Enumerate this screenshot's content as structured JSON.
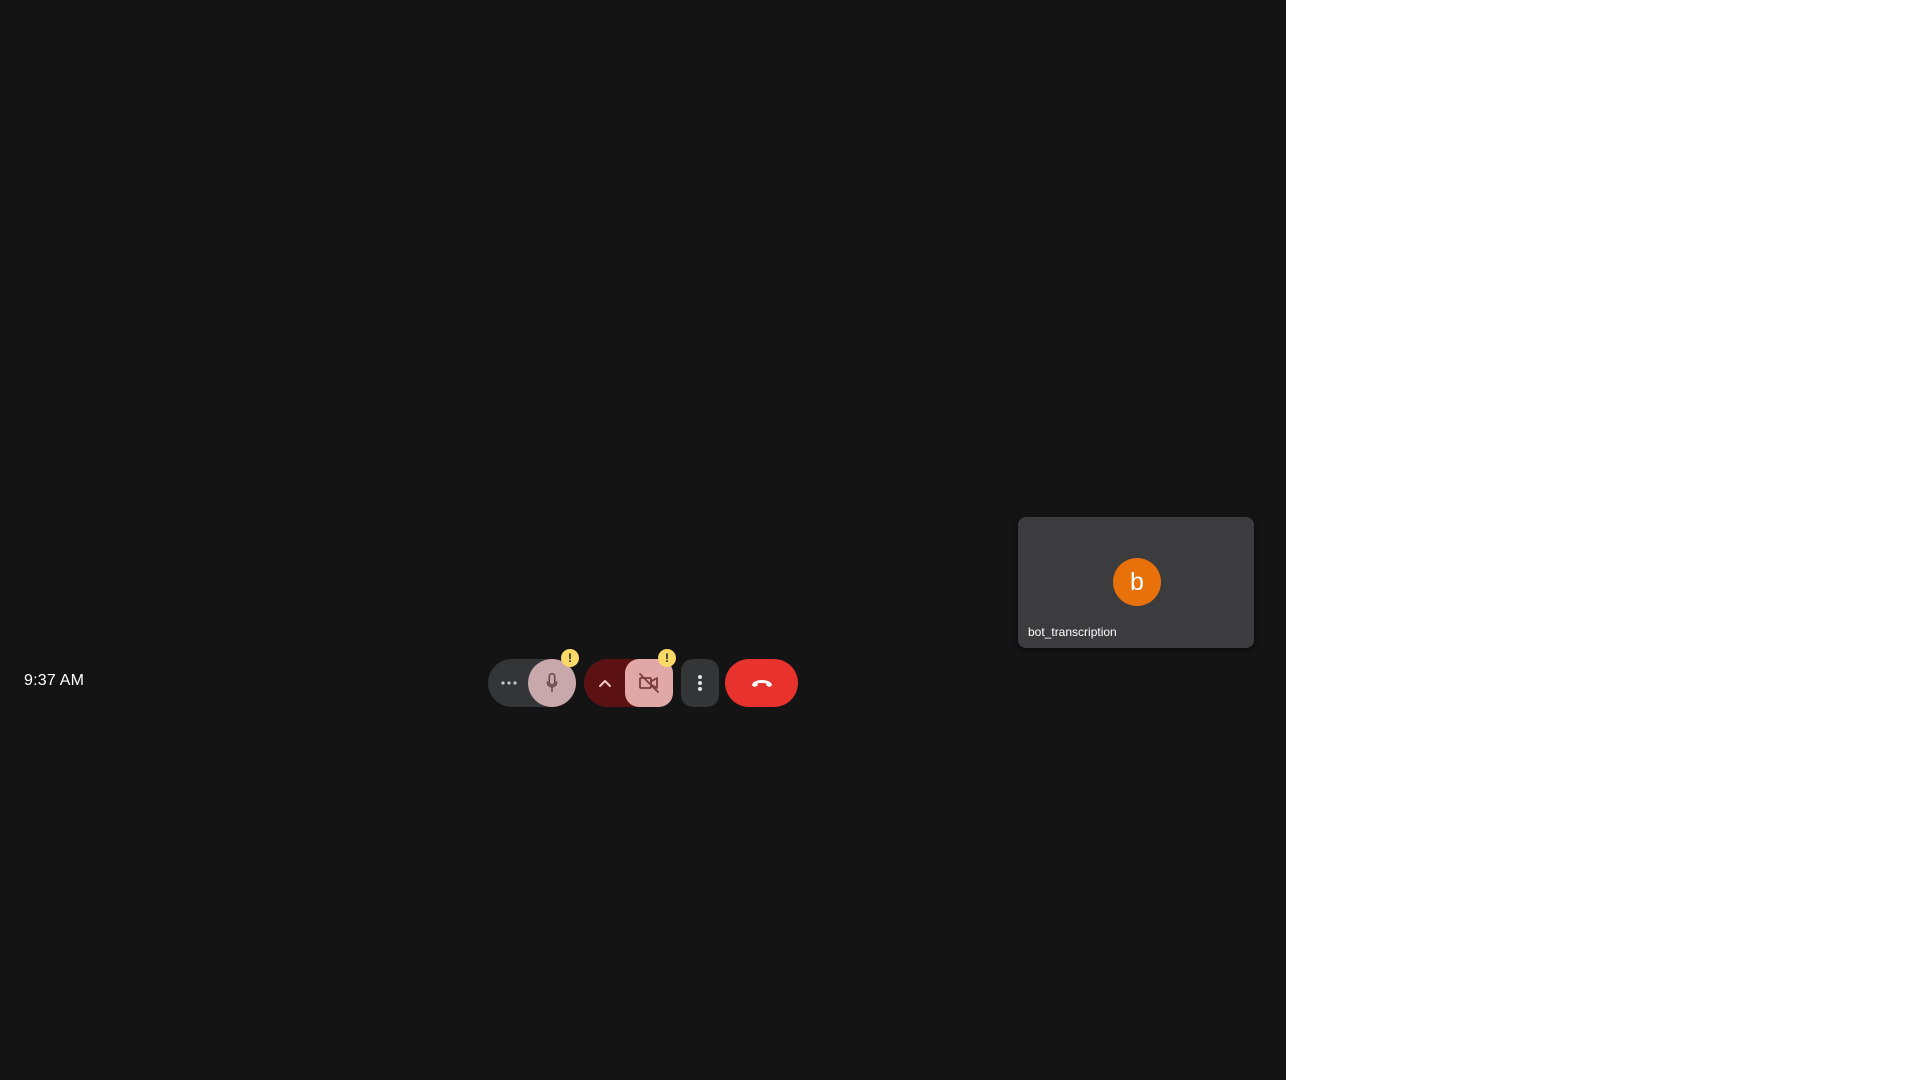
{
  "clock": {
    "time": "9:37 AM"
  },
  "participant": {
    "initial": "b",
    "name": "bot_transcription",
    "avatar_color": "#e8710a"
  },
  "controls": {
    "audio_options_icon": "more-horizontal-icon",
    "mic_icon": "microphone-icon",
    "mic_warning": "!",
    "video_options_icon": "chevron-up-icon",
    "camera_icon": "video-off-icon",
    "camera_warning": "!",
    "more_options_icon": "more-vertical-icon",
    "end_call_icon": "phone-hangup-icon"
  },
  "colors": {
    "stage": "#141414",
    "tile": "#3c3c3e",
    "end_call": "#e8322d",
    "warning": "#fbd967",
    "mic_button": "#c8a8ab",
    "camera_button": "#e0a8a6",
    "video_group": "#5c1212"
  }
}
